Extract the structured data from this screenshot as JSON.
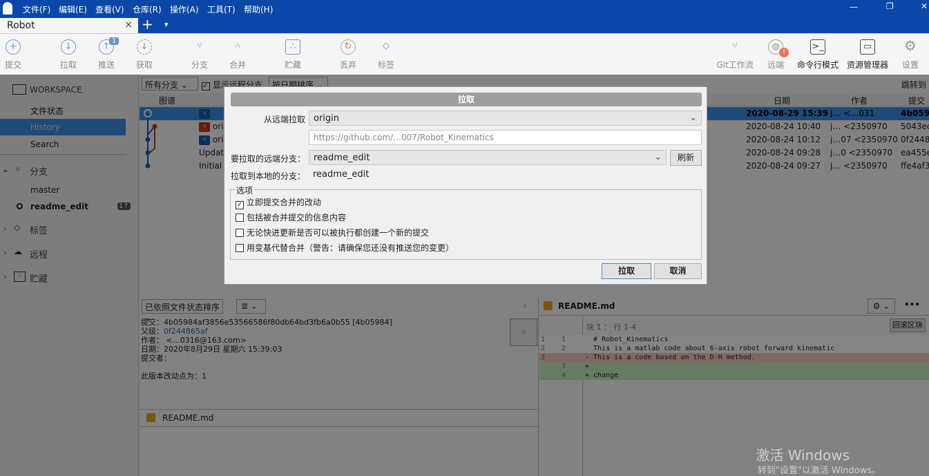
{
  "menu": [
    "文件(F)",
    "编辑(E)",
    "查看(V)",
    "仓库(R)",
    "操作(A)",
    "工具(T)",
    "帮助(H)"
  ],
  "tab": {
    "title": "Robot",
    "close": "×",
    "add": "+",
    "dropdown": "▾"
  },
  "toolbar": {
    "left": [
      {
        "label": "提交",
        "icon": "plus-circle-icon"
      },
      {
        "label": "拉取",
        "icon": "arrow-down-circle-icon"
      },
      {
        "label": "推送",
        "icon": "arrow-up-circle-icon",
        "badge": "1"
      },
      {
        "label": "获取",
        "icon": "fetch-icon"
      },
      {
        "label": "分支",
        "icon": "branch-icon"
      },
      {
        "label": "合并",
        "icon": "merge-icon"
      },
      {
        "label": "贮藏",
        "icon": "stash-icon"
      },
      {
        "label": "丢弃",
        "icon": "discard-icon"
      },
      {
        "label": "标签",
        "icon": "tag-icon"
      }
    ],
    "right": [
      {
        "label": "Git工作流",
        "icon": "git-flow-icon"
      },
      {
        "label": "远端",
        "icon": "globe-icon",
        "warning": "!"
      },
      {
        "label": "命令行模式",
        "icon": "terminal-icon"
      },
      {
        "label": "资源管理器",
        "icon": "folder-icon"
      },
      {
        "label": "设置",
        "icon": "gear-icon"
      }
    ]
  },
  "sidebar": {
    "workspace": "WORKSPACE",
    "items": [
      "文件状态",
      "History",
      "Search"
    ],
    "branches_header": "分支",
    "branches": [
      "master",
      "readme_edit"
    ],
    "branch_badge": "1↑",
    "tags": "标签",
    "remotes": "远程",
    "stashes": "贮藏"
  },
  "filters": {
    "branches": "所有分支",
    "show_remote": "显示远程分支",
    "sort": "按日期排序",
    "jump": "跳转到"
  },
  "columns": [
    "图谱",
    "描述",
    "日期",
    "作者",
    "提交"
  ],
  "commits": [
    {
      "desc": "",
      "date": "2020-08-29 15:39",
      "author": "j… <…031",
      "hash": "4b0598"
    },
    {
      "desc": "ori",
      "date": "2020-08-24 10:40",
      "author": "j… <2350970",
      "hash": "5043ec"
    },
    {
      "desc": "ori",
      "date": "2020-08-24 10:12",
      "author": "j…07 <2350970",
      "hash": "0f2448"
    },
    {
      "desc": "Updat",
      "date": "2020-08-24 09:28",
      "author": "j…0 <2350970",
      "hash": "ea455e"
    },
    {
      "desc": "Initial",
      "date": "2020-08-24 09:27",
      "author": "j… <2350970",
      "hash": "ffe4af3"
    }
  ],
  "details": {
    "sort": "已依照文件状态排序",
    "view": "≣",
    "commit_label": "提交：",
    "commit": "4b05984af3856e53566586f80db64bd3fb6a0b55 [4b05984]",
    "parent_label": "父级：",
    "parent": "0f244865af",
    "author_label": "作者：",
    "author": "<…0316@163.com>",
    "date_label": "日期：",
    "date": "2020年8月29日 星期六 15:39:03",
    "committer_label": "提交者：",
    "changes": "此版本改动点为：1",
    "file": "README.md"
  },
  "diff": {
    "file": "README.md",
    "hunk": "块 1 ： 行 1-4",
    "revert": "回滚区块",
    "lines": [
      {
        "old": "1",
        "new": "1",
        "text": "  # Robot_Kinematics",
        "type": "ctx"
      },
      {
        "old": "2",
        "new": "2",
        "text": "  This is a matlab code about 6-axis robot forward kinematic",
        "type": "ctx"
      },
      {
        "old": "3",
        "new": "",
        "text": "- This is a code based on the D-H method.",
        "type": "del"
      },
      {
        "old": "",
        "new": "3",
        "text": "+ ",
        "type": "add"
      },
      {
        "old": "",
        "new": "4",
        "text": "+ change",
        "type": "add"
      }
    ]
  },
  "dialog": {
    "title": "拉取",
    "remote_label": "从远端拉取",
    "remote": "origin",
    "url": "https://github.com/…007/Robot_Kinematics",
    "remote_branch_label": "要拉取的远端分支：",
    "remote_branch": "readme_edit",
    "refresh": "刷新",
    "local_branch_label": "拉取到本地的分支：",
    "local_branch": "readme_edit",
    "options_label": "选项",
    "options": [
      {
        "label": "立即提交合并的改动",
        "checked": true
      },
      {
        "label": "包括被合并提交的信息内容",
        "checked": false
      },
      {
        "label": "无论快进更新是否可以被执行都创建一个新的提交",
        "checked": false
      },
      {
        "label": "用变基代替合并（警告：请确保您还没有推送您的变更）",
        "checked": false
      }
    ],
    "ok": "拉取",
    "cancel": "取消"
  },
  "watermark": {
    "line1": "激活 Windows",
    "line2": "转到\"设置\"以激活 Windows。"
  }
}
